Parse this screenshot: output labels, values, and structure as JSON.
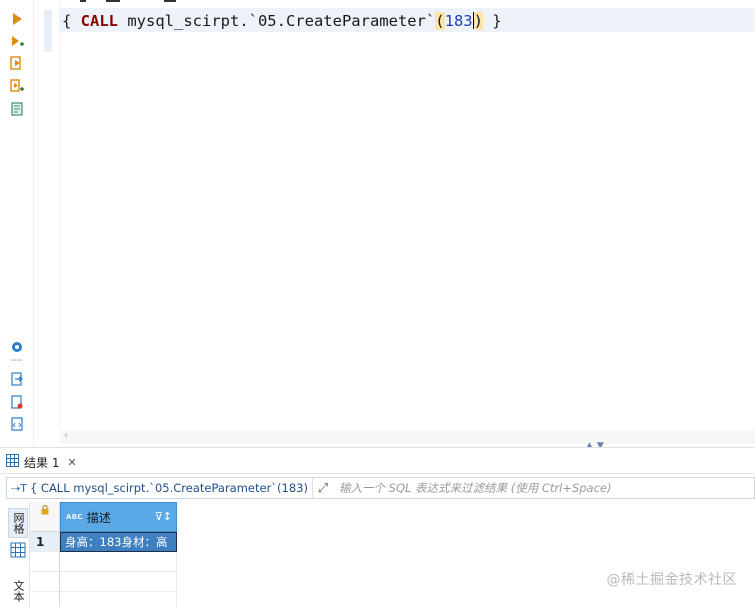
{
  "editor": {
    "code": {
      "open_brace": "{ ",
      "keyword": "CALL",
      "body": " mysql_scirpt.`05.CreateParameter`",
      "paren_open": "(",
      "argument": "183",
      "paren_close": ")",
      "close_brace": " }"
    }
  },
  "results": {
    "tab_label": "结果 1",
    "tab_close": "✕",
    "filter": {
      "query_text": "{ CALL mysql_scirpt.`05.CreateParameter`(183)",
      "placeholder": "输入一个 SQL 表达式来过滤结果 (使用 Ctrl+Space)"
    },
    "side_tabs": {
      "grid_label": "网格",
      "text_label": "文本"
    },
    "grid": {
      "columns": [
        {
          "type_badge": "ABC",
          "name": "描述"
        }
      ],
      "rows": [
        {
          "num": "1",
          "cells": [
            "身高：183身材：高"
          ]
        }
      ]
    }
  },
  "watermark": "@稀土掘金技术社区",
  "colors": {
    "keyword": "#8b0000",
    "number": "#1e3fbf",
    "header_bg": "#5aa9e6",
    "selected_cell": "#3f7fbf"
  }
}
